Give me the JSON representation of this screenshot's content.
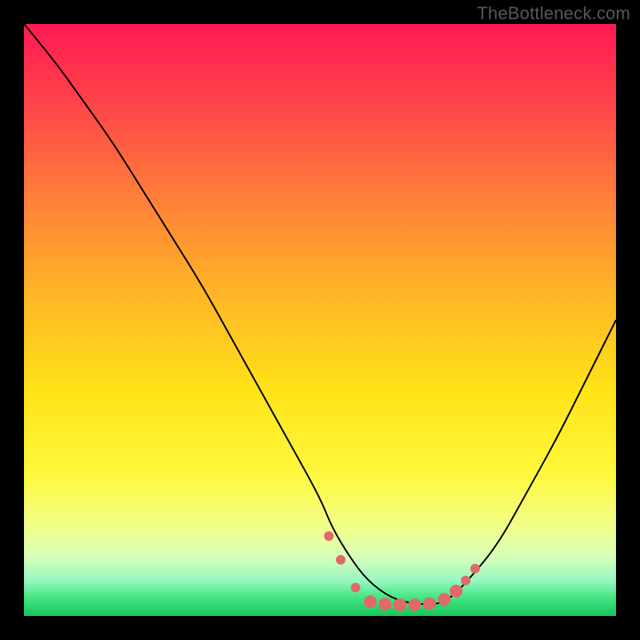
{
  "watermark": "TheBottleneck.com",
  "chart_data": {
    "type": "line",
    "title": "",
    "xlabel": "",
    "ylabel": "",
    "xlim": [
      0,
      100
    ],
    "ylim": [
      0,
      100
    ],
    "grid": false,
    "legend": false,
    "background_gradient": {
      "stops": [
        {
          "pos": 0.0,
          "color": "#ff1a54"
        },
        {
          "pos": 0.12,
          "color": "#ff3f4a"
        },
        {
          "pos": 0.28,
          "color": "#ff7a3a"
        },
        {
          "pos": 0.45,
          "color": "#ffb327"
        },
        {
          "pos": 0.62,
          "color": "#ffe318"
        },
        {
          "pos": 0.76,
          "color": "#fff83e"
        },
        {
          "pos": 0.85,
          "color": "#f0ff8a"
        },
        {
          "pos": 0.9,
          "color": "#d7ffb9"
        },
        {
          "pos": 0.94,
          "color": "#97f7c2"
        },
        {
          "pos": 0.97,
          "color": "#41e57f"
        },
        {
          "pos": 1.0,
          "color": "#19c45e"
        }
      ]
    },
    "series": [
      {
        "name": "curve",
        "stroke": "#000000",
        "stroke_width": 2,
        "x": [
          0,
          5,
          10,
          15,
          20,
          25,
          30,
          35,
          40,
          45,
          50,
          52,
          55,
          58,
          62,
          66,
          70,
          72,
          75,
          80,
          85,
          90,
          95,
          100
        ],
        "y": [
          100,
          94,
          87,
          80,
          72,
          64,
          56,
          47,
          38,
          29,
          20,
          15,
          10,
          6,
          3,
          2,
          2,
          3,
          6,
          12,
          21,
          30,
          40,
          50
        ]
      }
    ],
    "markers": {
      "color": "#e06a6a",
      "radius_small": 6,
      "radius_large": 8,
      "points": [
        {
          "x": 51.5,
          "y": 13.5,
          "r": "small"
        },
        {
          "x": 53.5,
          "y": 9.5,
          "r": "small"
        },
        {
          "x": 56.0,
          "y": 4.8,
          "r": "small"
        },
        {
          "x": 58.5,
          "y": 2.4,
          "r": "large"
        },
        {
          "x": 61.0,
          "y": 2.0,
          "r": "large"
        },
        {
          "x": 63.5,
          "y": 1.9,
          "r": "large"
        },
        {
          "x": 66.0,
          "y": 1.9,
          "r": "large"
        },
        {
          "x": 68.5,
          "y": 2.1,
          "r": "large"
        },
        {
          "x": 71.0,
          "y": 2.8,
          "r": "large"
        },
        {
          "x": 73.0,
          "y": 4.2,
          "r": "large"
        },
        {
          "x": 74.6,
          "y": 6.0,
          "r": "small"
        },
        {
          "x": 76.2,
          "y": 8.0,
          "r": "small"
        }
      ]
    }
  }
}
